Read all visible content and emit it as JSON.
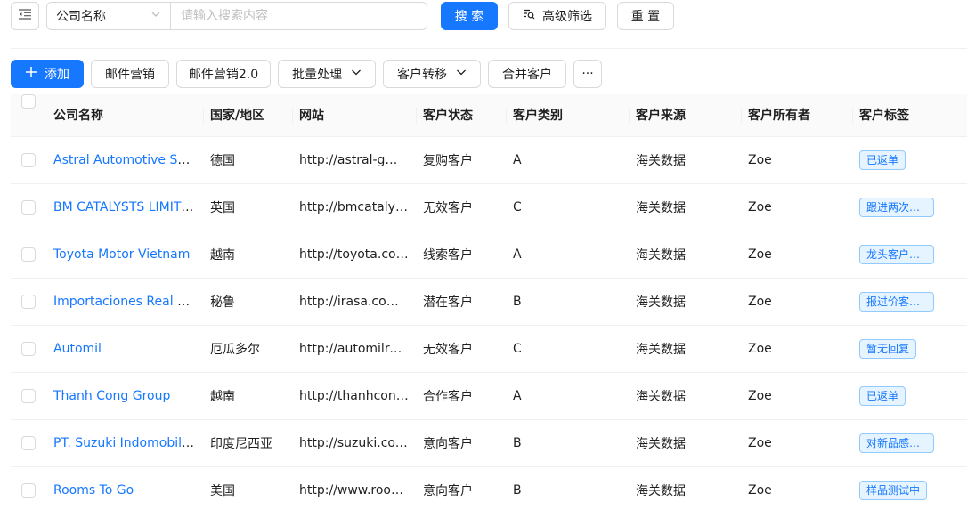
{
  "search": {
    "field_label": "公司名称",
    "placeholder": "请输入搜索内容",
    "search_button": "搜 索",
    "advanced_filter": "高级筛选",
    "reset_button": "重 置"
  },
  "toolbar": {
    "add": "添加",
    "email_marketing": "邮件营销",
    "email_marketing_2": "邮件营销2.0",
    "batch_process": "批量处理",
    "transfer_customer": "客户转移",
    "merge_customer": "合并客户",
    "more": "···"
  },
  "table": {
    "columns": [
      "公司名称",
      "国家/地区",
      "网站",
      "客户状态",
      "客户类别",
      "客户来源",
      "客户所有者",
      "客户标签"
    ],
    "rows": [
      {
        "company": "Astral Automotive Systems",
        "country": "德国",
        "website": "http://astral-gmbh.de",
        "status": "复购客户",
        "category": "A",
        "source": "海关数据",
        "owner": "Zoe",
        "tag": "已返单"
      },
      {
        "company": "BM CATALYSTS LIMITED",
        "country": "英国",
        "website": "http://bmcatalysts.co.uk",
        "status": "无效客户",
        "category": "C",
        "source": "海关数据",
        "owner": "Zoe",
        "tag": "跟进两次无回复"
      },
      {
        "company": "Toyota Motor Vietnam",
        "country": "越南",
        "website": "http://toyota.com.vn",
        "status": "线索客户",
        "category": "A",
        "source": "海关数据",
        "owner": "Zoe",
        "tag": "龙头客户，重点跟进"
      },
      {
        "company": "Importaciones Real Automotriz",
        "country": "秘鲁",
        "website": "http://irasa.com.pe",
        "status": "潜在客户",
        "category": "B",
        "source": "海关数据",
        "owner": "Zoe",
        "tag": "报过价客户未回复"
      },
      {
        "company": "Automil",
        "country": "厄瓜多尔",
        "website": "http://automilrepuestos.com",
        "status": "无效客户",
        "category": "C",
        "source": "海关数据",
        "owner": "Zoe",
        "tag": "暂无回复"
      },
      {
        "company": "Thanh Cong Group",
        "country": "越南",
        "website": "http://thanhcong.com.vn",
        "status": "合作客户",
        "category": "A",
        "source": "海关数据",
        "owner": "Zoe",
        "tag": "已返单"
      },
      {
        "company": "PT. Suzuki Indomobil Motor",
        "country": "印度尼西亚",
        "website": "http://suzuki.co.id",
        "status": "意向客户",
        "category": "B",
        "source": "海关数据",
        "owner": "Zoe",
        "tag": "对新品感兴趣"
      },
      {
        "company": "Rooms To Go",
        "country": "美国",
        "website": "http://www.roomstogo.com",
        "status": "意向客户",
        "category": "B",
        "source": "海关数据",
        "owner": "Zoe",
        "tag": "样品测试中"
      }
    ]
  }
}
